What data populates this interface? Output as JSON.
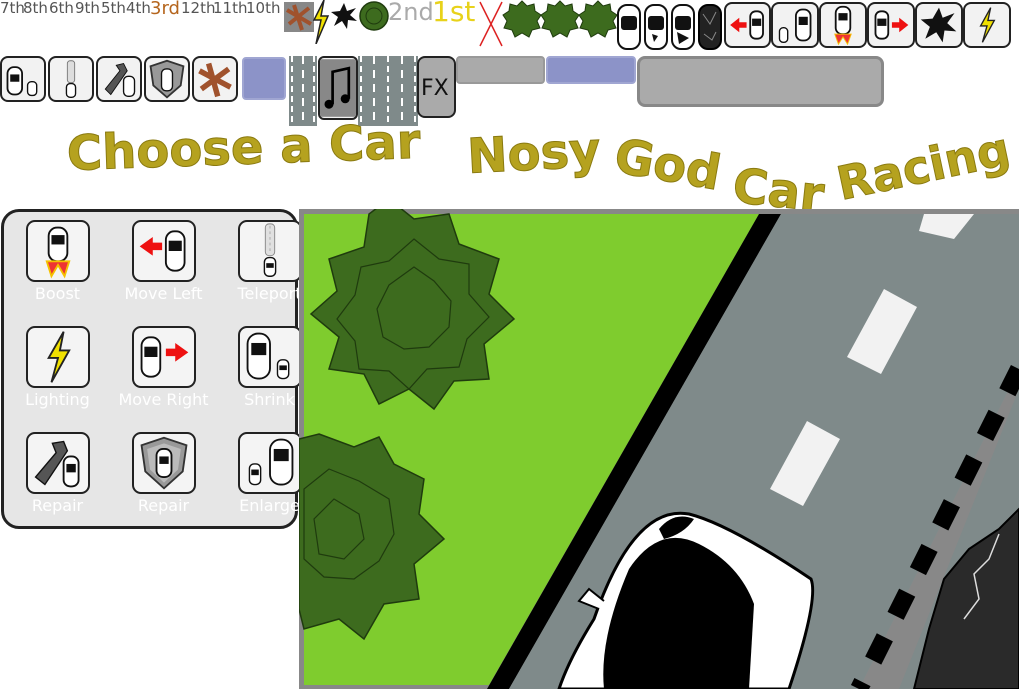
{
  "rank_labels": {
    "seventh": "7th",
    "eighth": "8th",
    "sixth": "6th",
    "ninth": "9th",
    "fifth": "5th",
    "fourth": "4th",
    "third": "3rd",
    "twelfth": "12th",
    "eleventh": "11th",
    "tenth": "10th",
    "second": "2nd",
    "first": "1st"
  },
  "buttons": {
    "fx_label": "FX"
  },
  "titles": {
    "choose_car": "Choose a Car",
    "nosy": "Nosy",
    "god": "God",
    "car": "Car",
    "racing": "Racing"
  },
  "powers": [
    {
      "label": "Boost",
      "icon": "boost-car-icon"
    },
    {
      "label": "Move Left",
      "icon": "move-left-icon"
    },
    {
      "label": "Teleport",
      "icon": "teleport-icon"
    },
    {
      "label": "Lighting",
      "icon": "lightning-icon"
    },
    {
      "label": "Move Right",
      "icon": "move-right-icon"
    },
    {
      "label": "Shrink",
      "icon": "shrink-icon"
    },
    {
      "label": "Repair",
      "icon": "wrench-icon"
    },
    {
      "label": "Repair",
      "icon": "shield-icon"
    },
    {
      "label": "Enlarge",
      "icon": "enlarge-icon"
    }
  ],
  "colors": {
    "grass": "#7fcc2e",
    "road": "#7f8a8a",
    "tree": "#3d6b1e",
    "title_gold": "#b5a21f",
    "accent_blue": "#8c93c8"
  }
}
